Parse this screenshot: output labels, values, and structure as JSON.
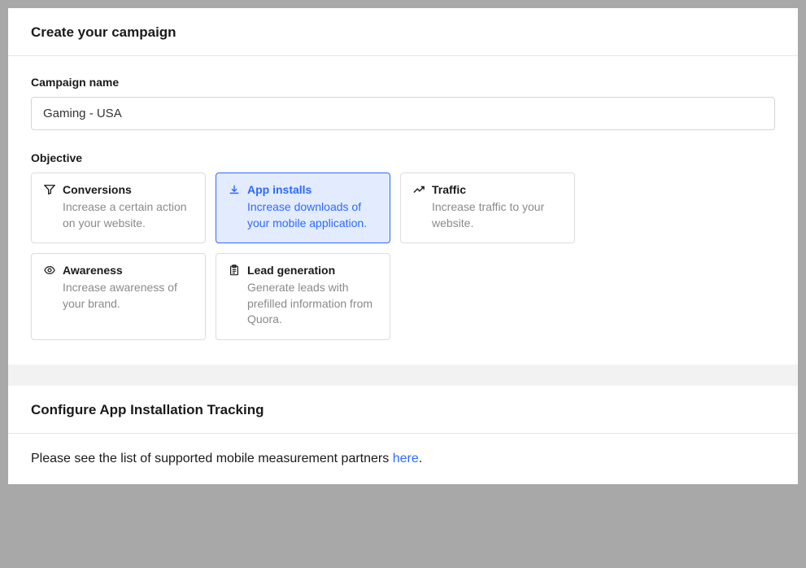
{
  "campaign": {
    "header": "Create your campaign",
    "name_label": "Campaign name",
    "name_value": "Gaming - USA",
    "objective_label": "Objective",
    "objectives": [
      {
        "key": "conversions",
        "title": "Conversions",
        "desc": "Increase a certain action on your website.",
        "selected": false
      },
      {
        "key": "app-installs",
        "title": "App installs",
        "desc": "Increase downloads of your mobile application.",
        "selected": true
      },
      {
        "key": "traffic",
        "title": "Traffic",
        "desc": "Increase traffic to your website.",
        "selected": false
      },
      {
        "key": "awareness",
        "title": "Awareness",
        "desc": "Increase awareness of your brand.",
        "selected": false
      },
      {
        "key": "lead-generation",
        "title": "Lead generation",
        "desc": "Generate leads with prefilled information from Quora.",
        "selected": false
      }
    ]
  },
  "tracking": {
    "header": "Configure App Installation Tracking",
    "text_prefix": "Please see the list of supported mobile measurement partners ",
    "link_text": "here",
    "text_suffix": "."
  }
}
